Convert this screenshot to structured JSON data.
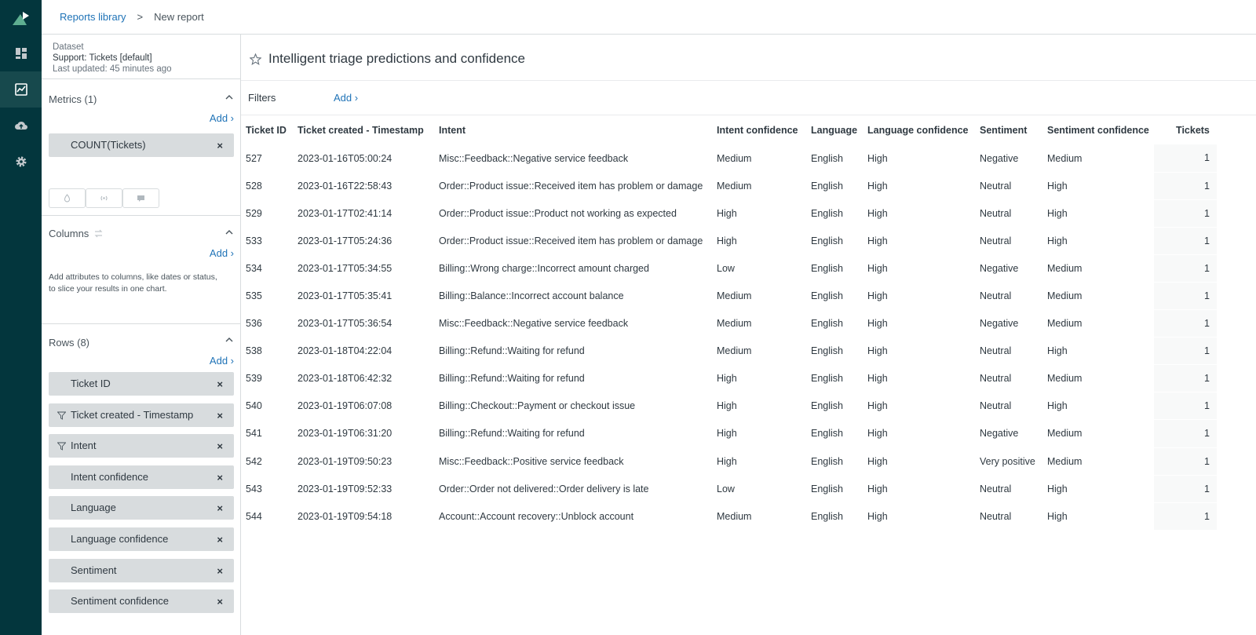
{
  "nav": {
    "items": [
      {
        "icon": "dashboard-icon"
      },
      {
        "icon": "reports-chart-icon"
      },
      {
        "icon": "cloud-upload-icon"
      },
      {
        "icon": "gear-icon"
      }
    ]
  },
  "breadcrumb": {
    "root": "Reports library",
    "separator": ">",
    "current": "New report"
  },
  "dataset": {
    "label": "Dataset",
    "name": "Support: Tickets [default]",
    "updated": "Last updated: 45 minutes ago"
  },
  "metrics": {
    "title": "Metrics (1)",
    "add": "Add ›",
    "items": [
      "COUNT(Tickets)"
    ]
  },
  "columns": {
    "title": "Columns",
    "add": "Add ›",
    "help": "Add attributes to columns, like dates or status, to slice your results in one chart."
  },
  "rows": {
    "title": "Rows (8)",
    "add": "Add ›",
    "items": [
      {
        "label": "Ticket ID",
        "filtered": false
      },
      {
        "label": "Ticket created - Timestamp",
        "filtered": true
      },
      {
        "label": "Intent",
        "filtered": true
      },
      {
        "label": "Intent confidence",
        "filtered": false
      },
      {
        "label": "Language",
        "filtered": false
      },
      {
        "label": "Language confidence",
        "filtered": false
      },
      {
        "label": "Sentiment",
        "filtered": false
      },
      {
        "label": "Sentiment confidence",
        "filtered": false
      }
    ]
  },
  "report": {
    "title": "Intelligent triage predictions and confidence"
  },
  "filters": {
    "label": "Filters",
    "add": "Add ›"
  },
  "table": {
    "headers": [
      "Ticket ID",
      "Ticket created - Timestamp",
      "Intent",
      "Intent confidence",
      "Language",
      "Language confidence",
      "Sentiment",
      "Sentiment confidence",
      "Tickets"
    ],
    "rows": [
      [
        "527",
        "2023-01-16T05:00:24",
        "Misc::Feedback::Negative service feedback",
        "Medium",
        "English",
        "High",
        "Negative",
        "Medium",
        "1"
      ],
      [
        "528",
        "2023-01-16T22:58:43",
        "Order::Product issue::Received item has problem or damage",
        "Medium",
        "English",
        "High",
        "Neutral",
        "High",
        "1"
      ],
      [
        "529",
        "2023-01-17T02:41:14",
        "Order::Product issue::Product not working as expected",
        "High",
        "English",
        "High",
        "Neutral",
        "High",
        "1"
      ],
      [
        "533",
        "2023-01-17T05:24:36",
        "Order::Product issue::Received item has problem or damage",
        "High",
        "English",
        "High",
        "Neutral",
        "High",
        "1"
      ],
      [
        "534",
        "2023-01-17T05:34:55",
        "Billing::Wrong charge::Incorrect amount charged",
        "Low",
        "English",
        "High",
        "Negative",
        "Medium",
        "1"
      ],
      [
        "535",
        "2023-01-17T05:35:41",
        "Billing::Balance::Incorrect account balance",
        "Medium",
        "English",
        "High",
        "Neutral",
        "Medium",
        "1"
      ],
      [
        "536",
        "2023-01-17T05:36:54",
        "Misc::Feedback::Negative service feedback",
        "Medium",
        "English",
        "High",
        "Negative",
        "Medium",
        "1"
      ],
      [
        "538",
        "2023-01-18T04:22:04",
        "Billing::Refund::Waiting for refund",
        "Medium",
        "English",
        "High",
        "Neutral",
        "High",
        "1"
      ],
      [
        "539",
        "2023-01-18T06:42:32",
        "Billing::Refund::Waiting for refund",
        "High",
        "English",
        "High",
        "Neutral",
        "Medium",
        "1"
      ],
      [
        "540",
        "2023-01-19T06:07:08",
        "Billing::Checkout::Payment or checkout issue",
        "High",
        "English",
        "High",
        "Neutral",
        "High",
        "1"
      ],
      [
        "541",
        "2023-01-19T06:31:20",
        "Billing::Refund::Waiting for refund",
        "High",
        "English",
        "High",
        "Negative",
        "Medium",
        "1"
      ],
      [
        "542",
        "2023-01-19T09:50:23",
        "Misc::Feedback::Positive service feedback",
        "High",
        "English",
        "High",
        "Very positive",
        "Medium",
        "1"
      ],
      [
        "543",
        "2023-01-19T09:52:33",
        "Order::Order not delivered::Order delivery is late",
        "Low",
        "English",
        "High",
        "Neutral",
        "High",
        "1"
      ],
      [
        "544",
        "2023-01-19T09:54:18",
        "Account::Account recovery::Unblock account",
        "Medium",
        "English",
        "High",
        "Neutral",
        "High",
        "1"
      ]
    ]
  },
  "colors": {
    "nav_bg": "#03363d",
    "nav_active": "#17494d",
    "link": "#1f73b7",
    "pill_bg": "#d8dcde",
    "logo": "#78a300"
  }
}
